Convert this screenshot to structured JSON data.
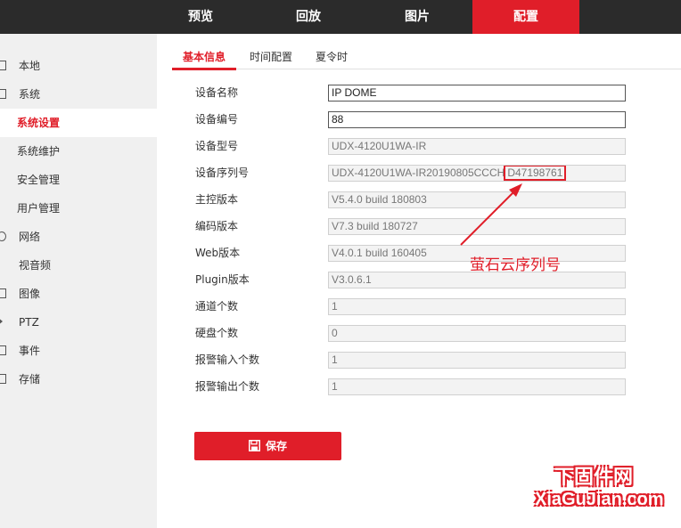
{
  "topnav": {
    "items": [
      {
        "label": "预览"
      },
      {
        "label": "回放"
      },
      {
        "label": "图片"
      },
      {
        "label": "配置",
        "active": true
      }
    ]
  },
  "sidebar": {
    "items": [
      {
        "label": "本地",
        "icon": "monitor-icon"
      },
      {
        "label": "系统",
        "icon": "system-icon"
      },
      {
        "label": "系统设置",
        "sub": true,
        "active": true
      },
      {
        "label": "系统维护",
        "sub": true
      },
      {
        "label": "安全管理",
        "sub": true
      },
      {
        "label": "用户管理",
        "sub": true
      },
      {
        "label": "网络",
        "icon": "network-icon"
      },
      {
        "label": "视音频",
        "icon": "audio-video-icon"
      },
      {
        "label": "图像",
        "icon": "image-icon"
      },
      {
        "label": "PTZ",
        "icon": "ptz-icon"
      },
      {
        "label": "事件",
        "icon": "event-icon"
      },
      {
        "label": "存储",
        "icon": "storage-icon"
      }
    ]
  },
  "tabs": [
    {
      "label": "基本信息",
      "active": true
    },
    {
      "label": "时间配置"
    },
    {
      "label": "夏令时"
    }
  ],
  "form": {
    "rows": [
      {
        "label": "设备名称",
        "value": "IP DOME",
        "editable": true
      },
      {
        "label": "设备编号",
        "value": "88",
        "editable": true
      },
      {
        "label": "设备型号",
        "value": "UDX-4120U1WA-IR"
      },
      {
        "label": "设备序列号",
        "value_prefix": "UDX-4120U1WA-IR20190805CCCH",
        "value_highlight": "D47198761"
      },
      {
        "label": "主控版本",
        "value": "V5.4.0 build 180803"
      },
      {
        "label": "编码版本",
        "value": "V7.3 build 180727"
      },
      {
        "label": "Web版本",
        "value": "V4.0.1 build 160405"
      },
      {
        "label": "Plugin版本",
        "value": "V3.0.6.1"
      },
      {
        "label": "通道个数",
        "value": "1"
      },
      {
        "label": "硬盘个数",
        "value": "0"
      },
      {
        "label": "报警输入个数",
        "value": "1"
      },
      {
        "label": "报警输出个数",
        "value": "1"
      }
    ]
  },
  "save_button": {
    "label": "保存",
    "icon": "floppy-disk-icon"
  },
  "annotation": {
    "text": "萤石云序列号",
    "color": "#e01e29"
  },
  "watermark": {
    "line1": "下固件网",
    "line2": "XiaGuJian.com"
  },
  "colors": {
    "accent": "#e01e29",
    "topbar": "#2b2b2b",
    "sidebar": "#f0f0f0"
  }
}
